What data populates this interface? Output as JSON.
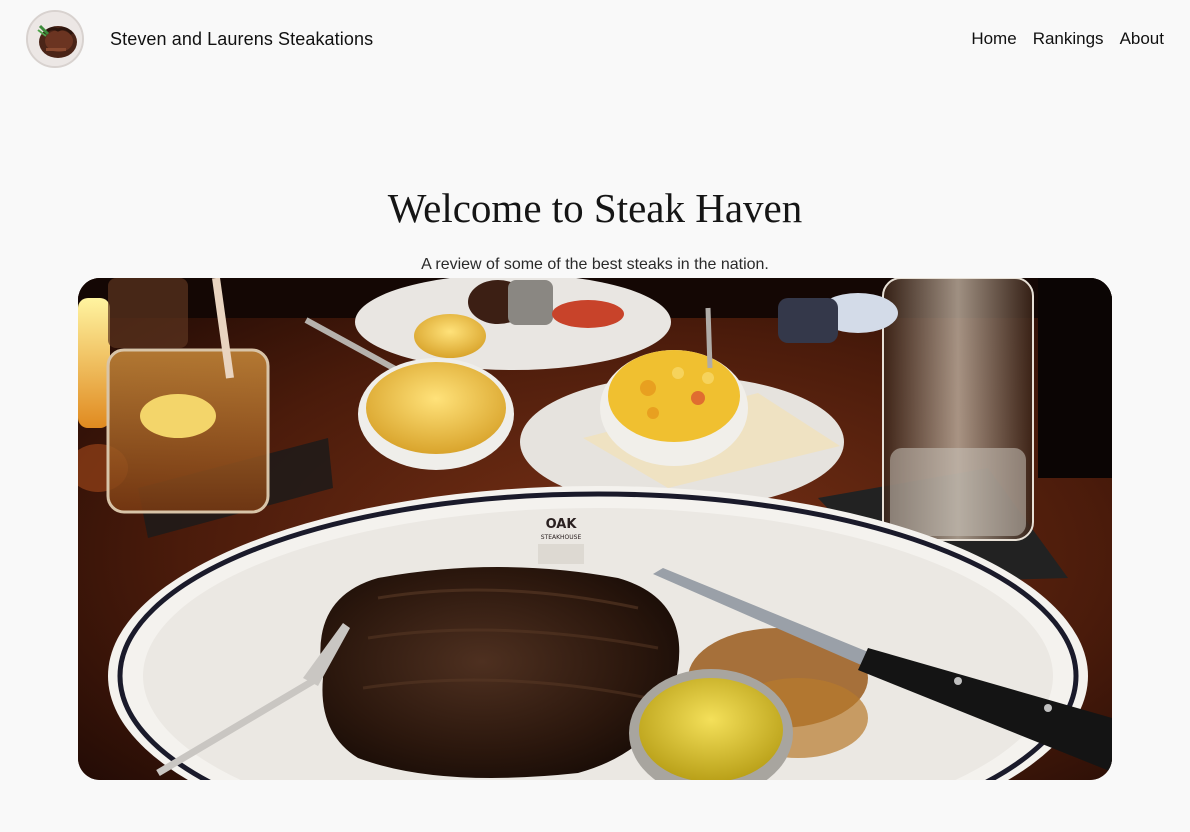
{
  "header": {
    "brand_name": "Steven and Laurens Steakations",
    "logo_icon": "steak-photo-icon",
    "nav": [
      {
        "label": "Home"
      },
      {
        "label": "Rankings"
      },
      {
        "label": "About"
      }
    ]
  },
  "hero": {
    "title": "Welcome to Steak Haven",
    "subtitle": "A review of some of the best steaks in the nation.",
    "photo": {
      "plate_brand_line1": "OAK",
      "plate_brand_line2": "STEAKHOUSE"
    }
  }
}
